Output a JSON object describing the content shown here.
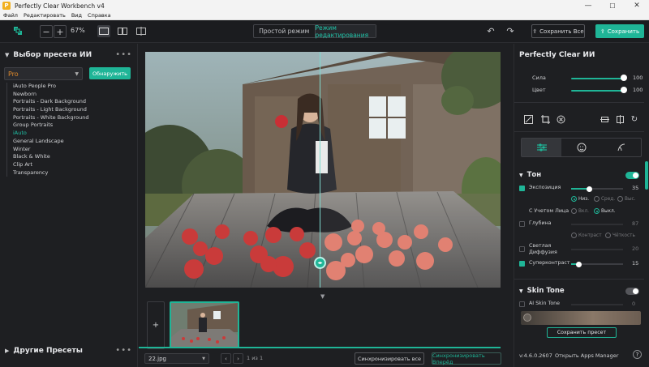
{
  "window": {
    "title": "Perfectly Clear Workbench v4",
    "minimize": "—",
    "maximize": "☐",
    "close": "✕"
  },
  "menu": [
    "Файл",
    "Редактировать",
    "Вид",
    "Справка"
  ],
  "toolbar": {
    "zoom_out": "−",
    "zoom_in": "+",
    "zoom_level": "67%",
    "mode_simple": "Простой режим",
    "mode_edit": "Режим редактирования",
    "save_all": "Сохранить Все",
    "save": "Сохранить"
  },
  "left": {
    "section_title": "Выбор пресета ИИ",
    "selected_preset": "Pro",
    "apply_button": "Обнаружить",
    "presets": [
      "iAuto People Pro",
      "Newborn",
      "Portraits - Dark Background",
      "Portraits - Light Background",
      "Portraits - White Background",
      "Group Portraits",
      "iAuto",
      "General Landscape",
      "Winter",
      "Black & White",
      "Clip Art",
      "Transparency"
    ],
    "active_preset_index": 6,
    "other_presets": "Другие Пресеты"
  },
  "center": {
    "file_name": "22.jpg",
    "page_info": "1 из 1",
    "sync_all": "Синхронизировать все",
    "sync_forward": "Синхронизировать Вперёд"
  },
  "right": {
    "title": "Perfectly Clear ИИ",
    "strength_label": "Сила",
    "strength_value": "100",
    "color_label": "Цвет",
    "color_value": "100",
    "tone_title": "Тон",
    "exposure_label": "Экспозиция",
    "exposure_value": "35",
    "exposure_amount": 35,
    "radio_low": "Низ.",
    "radio_mid": "Сред.",
    "radio_high": "Выс.",
    "face_label": "С Учетом Лица",
    "face_on": "Вкл.",
    "face_off": "Выкл.",
    "depth_label": "Глубина",
    "depth_value": "87",
    "contrast_opt": "Контраст",
    "clarity_opt": "Чёткость",
    "diffusion_label": "Светлая Диффузия",
    "diffusion_value": "20",
    "supercontrast_label": "Суперконтраст",
    "supercontrast_value": "15",
    "supercontrast_amount": 15,
    "skin_title": "Skin Tone",
    "ai_skin_label": "AI Skin Tone",
    "ai_skin_value": "0",
    "save_preset": "Сохранить пресет",
    "version": "v:4.6.0.2607",
    "apps_manager": "Открыть Apps Manager",
    "help": "?",
    "accent": "#1fb597"
  }
}
